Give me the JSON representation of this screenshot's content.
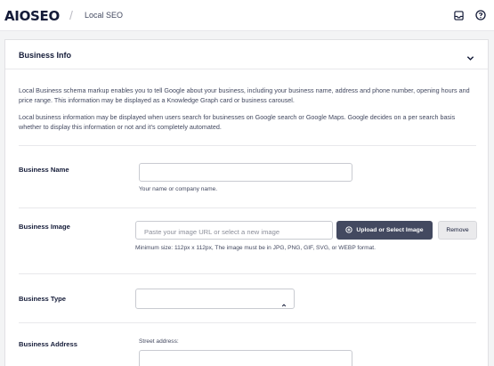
{
  "header": {
    "logo_text": "AIOSEO",
    "breadcrumb": "Local SEO",
    "icons": [
      "inbox-icon",
      "help-icon"
    ]
  },
  "panel": {
    "title": "Business Info",
    "description_1": "Local Business schema markup enables you to tell Google about your business, including your business name, address and phone number, opening hours and price range. This information may be displayed as a Knowledge Graph card or business carousel.",
    "description_2": "Local business information may be displayed when users search for businesses on Google search or Google Maps. Google decides on a per search basis whether to display this information or not and it's completely automated."
  },
  "fields": {
    "business_name": {
      "label": "Business Name",
      "value": "",
      "help": "Your name or company name."
    },
    "business_image": {
      "label": "Business Image",
      "placeholder": "Paste your image URL or select a new image",
      "upload_label": "Upload or Select Image",
      "remove_label": "Remove",
      "help": "Minimum size: 112px x 112px, The image must be in JPG, PNG, GIF, SVG, or WEBP format."
    },
    "business_type": {
      "label": "Business Type",
      "value": ""
    },
    "business_address": {
      "label": "Business Address",
      "street_label": "Street address:",
      "street_value": ""
    }
  },
  "colors": {
    "primary_dark": "#434960",
    "text": "#141b38",
    "background": "#f3f4f5"
  }
}
